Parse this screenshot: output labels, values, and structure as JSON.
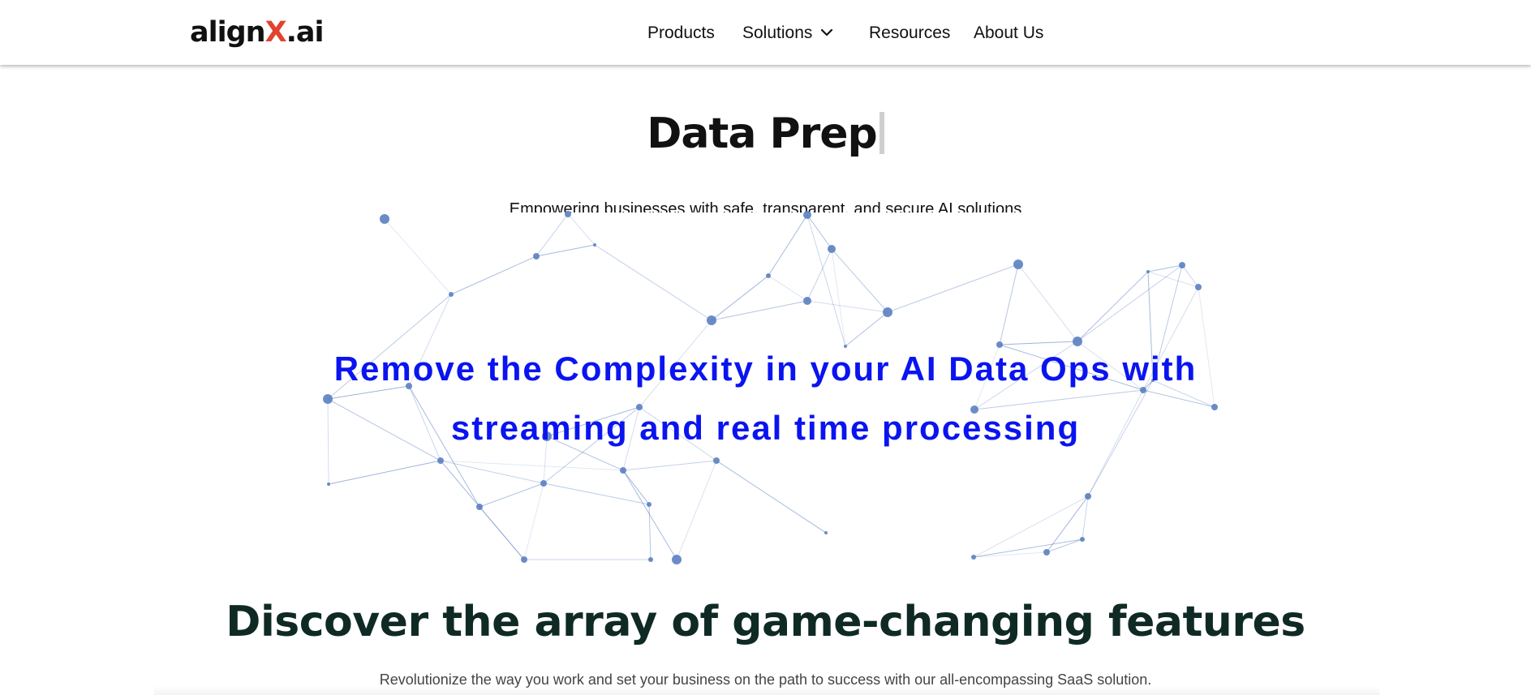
{
  "header": {
    "logo": {
      "prefix": "align",
      "x": "X",
      "suffix": ".ai"
    },
    "nav": [
      {
        "label": "Products"
      },
      {
        "label": "Solutions",
        "has_dropdown": true,
        "icon": "chevron-down-icon"
      },
      {
        "label": "Resources"
      },
      {
        "label": "About Us"
      }
    ]
  },
  "hero": {
    "typed_text": "Data Prep",
    "subtitle": "Empowering businesses with safe, transparent, and secure AI solutions",
    "headline_line1": "Remove the Complexity in your AI Data Ops with",
    "headline_line2": "streaming and real time processing"
  },
  "features": {
    "title": "Discover the array of game-changing features",
    "subtitle": "Revolutionize the way you work and set your business on the path to success with our all-encompassing SaaS solution."
  },
  "colors": {
    "logo_accent": "#e2432f",
    "headline": "#0a14f0",
    "features_title": "#0f2a25",
    "network_node": "#5b7fc0"
  }
}
